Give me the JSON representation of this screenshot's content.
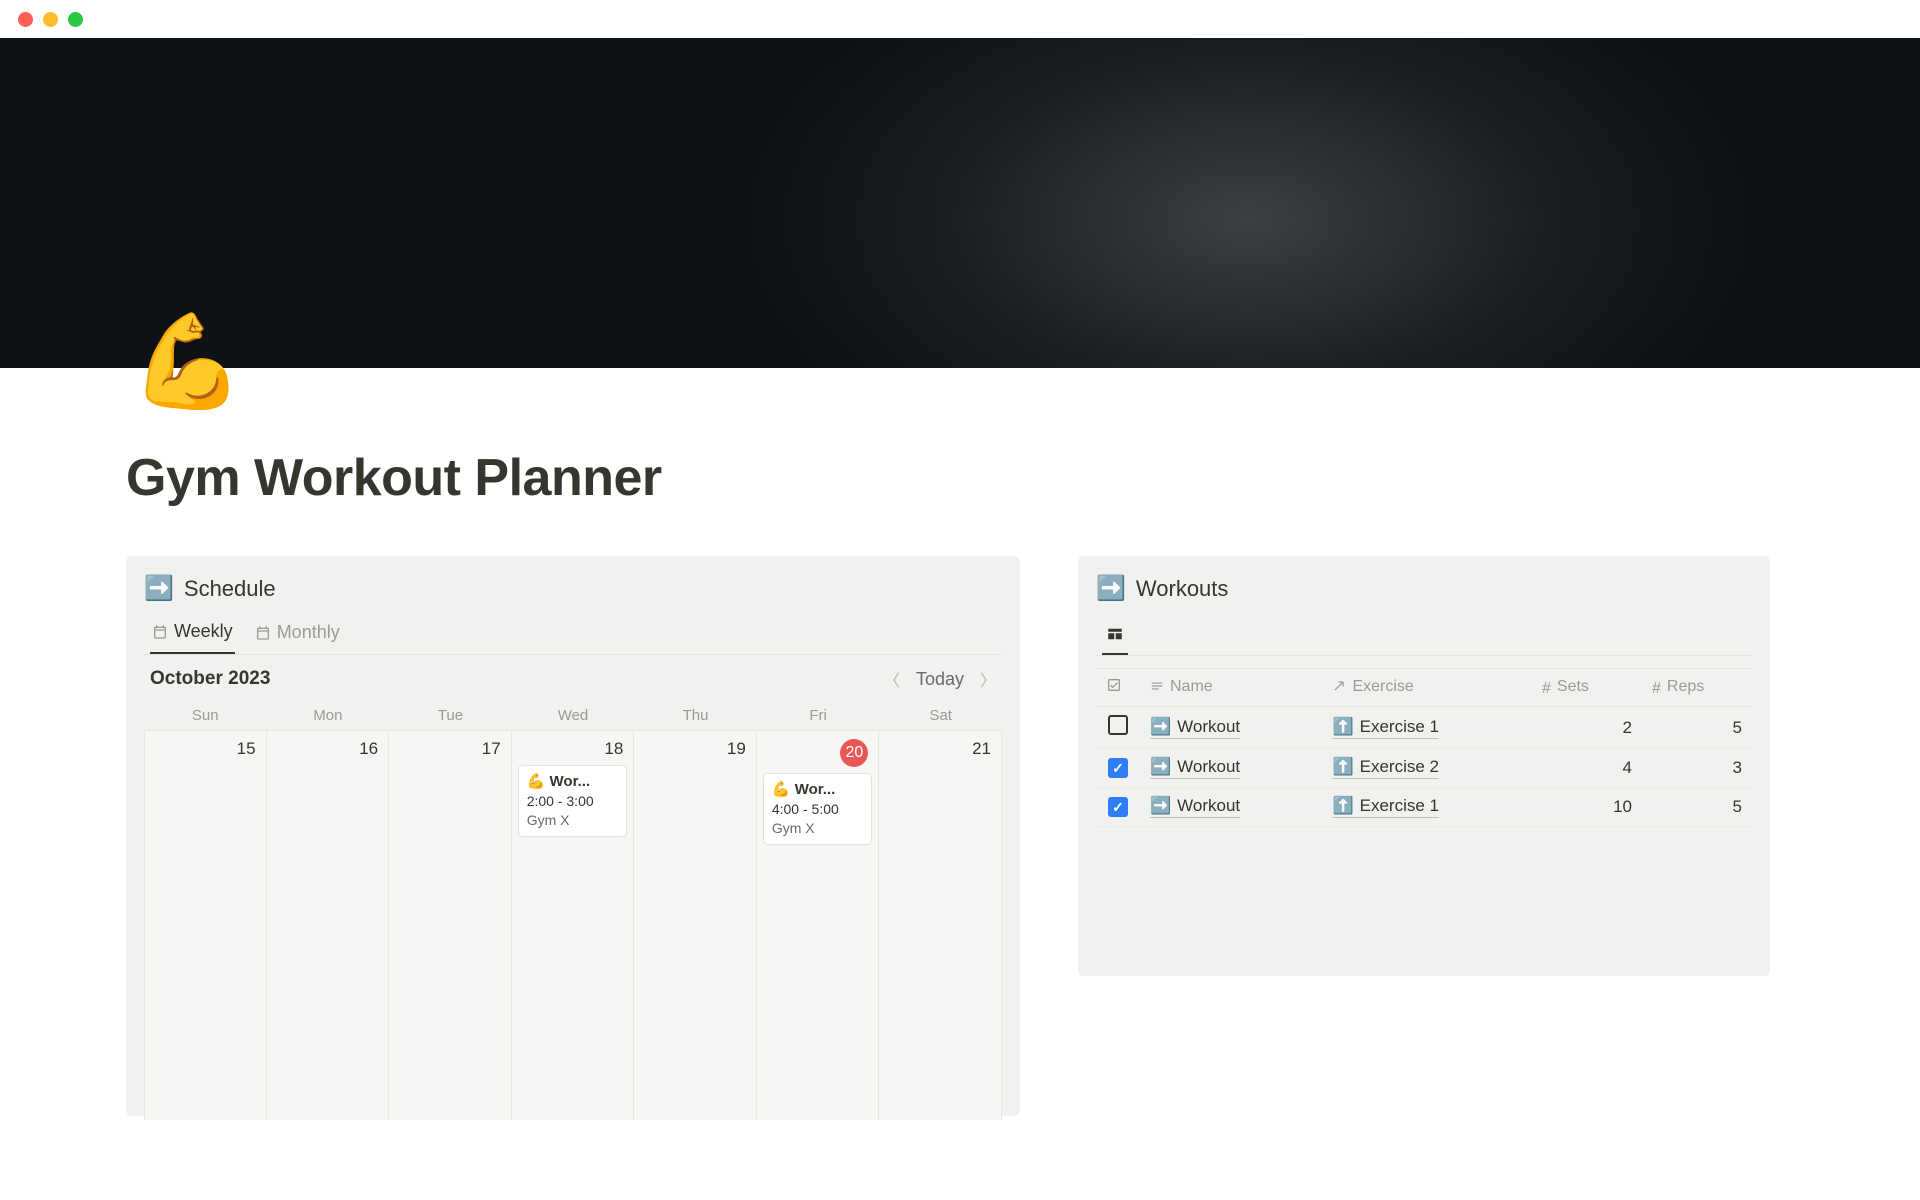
{
  "page": {
    "icon_emoji": "💪",
    "title": "Gym Workout Planner"
  },
  "schedule_panel": {
    "icon_emoji": "➡️",
    "title": "Schedule",
    "tabs": {
      "weekly": "Weekly",
      "monthly": "Monthly"
    },
    "month_label": "October 2023",
    "today_label": "Today",
    "dow": [
      "Sun",
      "Mon",
      "Tue",
      "Wed",
      "Thu",
      "Fri",
      "Sat"
    ],
    "days": [
      {
        "num": "15",
        "today": false,
        "events": []
      },
      {
        "num": "16",
        "today": false,
        "events": []
      },
      {
        "num": "17",
        "today": false,
        "events": []
      },
      {
        "num": "18",
        "today": false,
        "events": [
          {
            "emoji": "💪",
            "title": "Wor...",
            "time": "2:00 - 3:00",
            "loc": "Gym X"
          }
        ]
      },
      {
        "num": "19",
        "today": false,
        "events": []
      },
      {
        "num": "20",
        "today": true,
        "events": [
          {
            "emoji": "💪",
            "title": "Wor...",
            "time": "4:00 - 5:00",
            "loc": "Gym X"
          }
        ]
      },
      {
        "num": "21",
        "today": false,
        "events": []
      }
    ]
  },
  "workouts_panel": {
    "icon_emoji": "➡️",
    "title": "Workouts",
    "columns": {
      "name": "Name",
      "exercise": "Exercise",
      "sets": "Sets",
      "reps": "Reps"
    },
    "rows": [
      {
        "checked": false,
        "name_icon": "➡️",
        "name": "Workout",
        "ex_icon": "⬆️",
        "exercise": "Exercise 1",
        "sets": "2",
        "reps": "5"
      },
      {
        "checked": true,
        "name_icon": "➡️",
        "name": "Workout",
        "ex_icon": "⬆️",
        "exercise": "Exercise 2",
        "sets": "4",
        "reps": "3"
      },
      {
        "checked": true,
        "name_icon": "➡️",
        "name": "Workout",
        "ex_icon": "⬆️",
        "exercise": "Exercise 1",
        "sets": "10",
        "reps": "5"
      }
    ]
  }
}
